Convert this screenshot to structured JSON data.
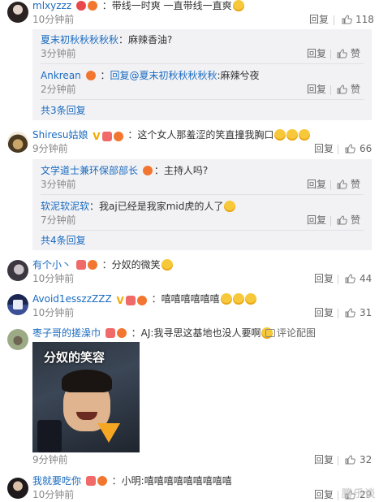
{
  "labels": {
    "reply": "回复",
    "like": "赞"
  },
  "comments": [
    {
      "user": "mlxyzzz",
      "text": "：带线一时爽 一直带线一直爽",
      "time": "10分钟前",
      "likes": "118",
      "replies": [
        {
          "user": "夏末初秋秋秋秋秋",
          "text": "：麻辣香油?",
          "time": "3分钟前"
        },
        {
          "user": "Ankrean",
          "mention": "回复@夏末初秋秋秋秋秋",
          "text": ":麻辣兮夜",
          "time": "2分钟前"
        }
      ],
      "more": "共3条回复"
    },
    {
      "user": "Shiresu姑娘",
      "text": "：这个女人那羞涩的笑直撞我胸口",
      "time": "9分钟前",
      "likes": "66",
      "replies": [
        {
          "user": "文学道士兼环保部部长",
          "text": "：主持人吗?",
          "time": "3分钟前"
        },
        {
          "user": "软泥软泥软",
          "text": "：我aj已经是我家mid虎的人了",
          "time": "7分钟前"
        }
      ],
      "more": "共4条回复"
    },
    {
      "user": "有个小丶",
      "text": "：分奴的微笑",
      "time": "10分钟前",
      "likes": "44"
    },
    {
      "user": "Avoid1esszzZZZ",
      "text": "：嘻嘻嘻嘻嘻嘻",
      "time": "10分钟前",
      "likes": "31"
    },
    {
      "user": "枣子哥的搓澡巾",
      "text": "：AJ:我寻思这基地也没人要啊",
      "comment_image_link": "评论配图",
      "image_caption": "分奴的笑容",
      "time": "9分钟前",
      "likes": "32"
    },
    {
      "user": "我就要吃你",
      "text": "：小明:嘻嘻嘻嘻嘻嘻嘻嘻嘻",
      "time": "10分钟前",
      "likes": "29"
    }
  ],
  "watermark": "腾乐谈"
}
